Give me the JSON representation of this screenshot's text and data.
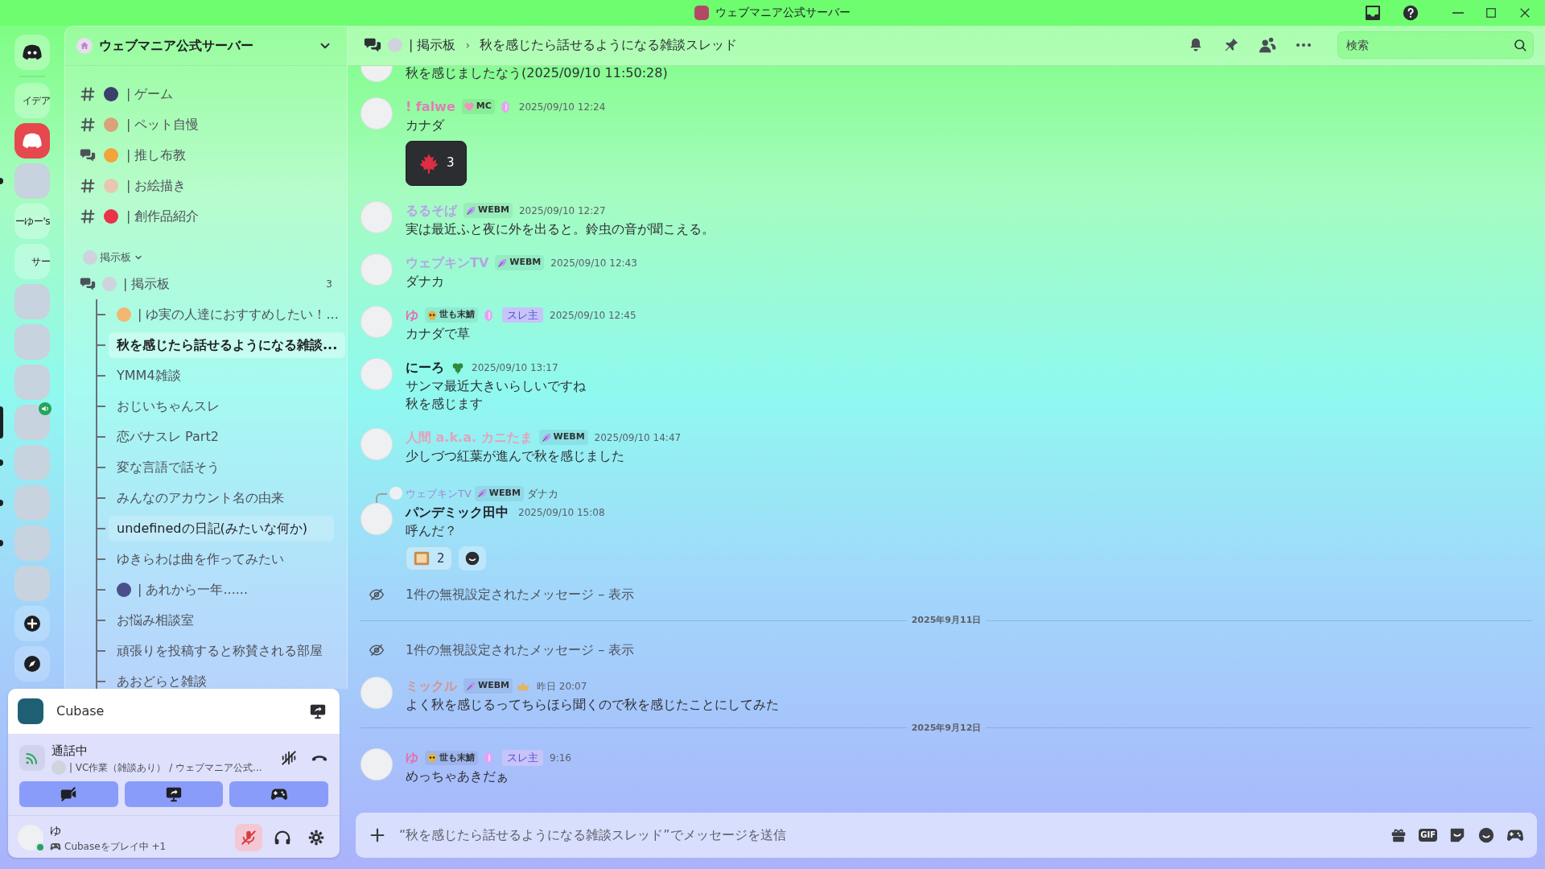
{
  "window": {
    "title": "ウェブマニア公式サーバー"
  },
  "servers": [
    {
      "kind": "home",
      "selected": false,
      "unread": false,
      "in_voice": false
    },
    {
      "kind": "text",
      "label": "イデア",
      "selected": false,
      "unread": false,
      "in_voice": false
    },
    {
      "kind": "logo",
      "selected": false,
      "unread": false,
      "in_voice": false
    },
    {
      "kind": "image",
      "selected": false,
      "unread": true,
      "in_voice": false
    },
    {
      "kind": "text",
      "label": "ーゆー's",
      "selected": false,
      "unread": false,
      "in_voice": false
    },
    {
      "kind": "text",
      "label": "サー",
      "selected": false,
      "unread": false,
      "in_voice": false
    },
    {
      "kind": "image",
      "selected": false,
      "unread": false,
      "in_voice": false
    },
    {
      "kind": "image",
      "selected": false,
      "unread": false,
      "in_voice": false
    },
    {
      "kind": "image",
      "selected": false,
      "unread": false,
      "in_voice": false
    },
    {
      "kind": "image",
      "selected": true,
      "unread": false,
      "in_voice": true
    },
    {
      "kind": "image",
      "selected": false,
      "unread": true,
      "in_voice": false
    },
    {
      "kind": "image",
      "selected": false,
      "unread": true,
      "in_voice": false
    },
    {
      "kind": "image",
      "selected": false,
      "unread": true,
      "in_voice": false
    },
    {
      "kind": "image",
      "selected": false,
      "unread": false,
      "in_voice": false
    },
    {
      "kind": "add",
      "selected": false,
      "unread": false,
      "in_voice": false
    },
    {
      "kind": "explore",
      "selected": false,
      "unread": false,
      "in_voice": false
    }
  ],
  "sidebar": {
    "server_name": "ウェブマニア公式サーバー",
    "channels": [
      {
        "kind": "text",
        "emoji": {
          "kind": "gamepad"
        },
        "name": "| ゲーム"
      },
      {
        "kind": "text",
        "emoji": {
          "kind": "dog"
        },
        "name": "| ペット自慢"
      },
      {
        "kind": "forum",
        "emoji": {
          "kind": "heart-eyes"
        },
        "name": "| 推し布教"
      },
      {
        "kind": "text",
        "emoji": {
          "kind": "palette"
        },
        "name": "| お絵描き"
      },
      {
        "kind": "text",
        "emoji": {
          "kind": "hearts"
        },
        "name": "| 創作品紹介"
      }
    ],
    "category": {
      "label": "掲示板",
      "expanded": true
    },
    "forum": {
      "name": "| 掲示板",
      "count": "3",
      "threads": [
        {
          "emoji": {
            "kind": "wink"
          },
          "name": "| ゆ実の人達におすすめしたい！...",
          "selected": false,
          "hovered": false
        },
        {
          "name": "秋を感じたら話せるようになる雑談...",
          "selected": true,
          "hovered": false
        },
        {
          "name": "YMM4雑談",
          "selected": false,
          "hovered": false
        },
        {
          "name": "おじいちゃんスレ",
          "selected": false,
          "hovered": false
        },
        {
          "name": "恋バナスレ Part2",
          "selected": false,
          "hovered": false
        },
        {
          "name": "変な言語で話そう",
          "selected": false,
          "hovered": false
        },
        {
          "name": "みんなのアカウント名の由来",
          "selected": false,
          "hovered": false
        },
        {
          "name": "undefinedの日記(みたいな何か)",
          "selected": false,
          "hovered": true
        },
        {
          "name": "ゆきらわは曲を作ってみたい",
          "selected": false,
          "hovered": false
        },
        {
          "emoji": {
            "kind": "gate"
          },
          "name": "| あれから一年......",
          "selected": false,
          "hovered": false
        },
        {
          "name": "お悩み相談室",
          "selected": false,
          "hovered": false
        },
        {
          "name": "頑張りを投稿すると称賛される部屋",
          "selected": false,
          "hovered": false
        },
        {
          "name": "あおどらと雑談",
          "selected": false,
          "hovered": false
        }
      ]
    }
  },
  "panel": {
    "activity": "Cubase",
    "voice_status": "通話中",
    "voice_channel": "| VC作業（雑談あり） / ウェブマニア公式...",
    "user": "ゆ",
    "user_status": "Cubaseをプレイ中 +1",
    "mic_muted": true
  },
  "header": {
    "forum": "| 掲示板",
    "separator": "›",
    "thread": "秋を感じたら話せるようになる雑談スレッド",
    "search": {
      "placeholder": "検索"
    }
  },
  "messages": [
    {
      "kind": "continuation",
      "lines": [
        "秋を感じましたなう(2025/09/10 11:50:28)"
      ]
    },
    {
      "kind": "message",
      "author": "! falwe",
      "color": "#e07fb6",
      "tag": {
        "kind": "heart",
        "label": "MC"
      },
      "boost": true,
      "time": "2025/09/10 12:24",
      "lines": [
        "カナダ"
      ],
      "reactions": [
        {
          "kind": "maple",
          "count": "3",
          "selected": true
        }
      ],
      "add_reaction": false
    },
    {
      "kind": "message",
      "author": "るるそば",
      "color": "#b7a2e8",
      "tag": {
        "kind": "leaf",
        "label": "WEBM"
      },
      "boost": false,
      "time": "2025/09/10 12:27",
      "lines": [
        "実は最近ふと夜に外を出ると。鈴虫の音が聞こえる。"
      ]
    },
    {
      "kind": "message",
      "author": "ウェブキンTV",
      "color": "#b3a6e4",
      "tag": {
        "kind": "leaf",
        "label": "WEBM"
      },
      "boost": false,
      "time": "2025/09/10 12:43",
      "lines": [
        "ダナカ"
      ]
    },
    {
      "kind": "message",
      "author": "ゆ",
      "color": "#e46fb0",
      "tag": {
        "kind": "skull",
        "label": "世も末鯖"
      },
      "boost": true,
      "role": "スレ主",
      "time": "2025/09/10 12:45",
      "lines": [
        "カナダで草"
      ]
    },
    {
      "kind": "message",
      "author": "にーろ",
      "color": "#1e1f22",
      "emblem": {
        "kind": "clover"
      },
      "boost": false,
      "time": "2025/09/10 13:17",
      "lines": [
        "サンマ最近大きいらしいですね",
        "秋を感じます"
      ]
    },
    {
      "kind": "message",
      "author": "人間 a.k.a. カニたま",
      "color": "#e3a3bd",
      "tag": {
        "kind": "leaf",
        "label": "WEBM"
      },
      "boost": false,
      "time": "2025/09/10 14:47",
      "lines": [
        "少しづつ紅葉が進んで秋を感じました"
      ]
    },
    {
      "kind": "message",
      "reply": {
        "author": "ウェブキンTV",
        "color": "#9f8ad6",
        "tag": {
          "kind": "leaf",
          "label": "WEBM"
        },
        "text": "ダナカ"
      },
      "author": "パンデミック田中",
      "color": "#1e1f22",
      "boost": false,
      "time": "2025/09/10 15:08",
      "lines": [
        "呼んだ？"
      ],
      "reactions": [
        {
          "kind": "grass",
          "count": "2",
          "selected": false
        }
      ],
      "add_reaction": true
    },
    {
      "kind": "ignored",
      "text": "1件の無視設定されたメッセージ –",
      "link": "表示"
    },
    {
      "kind": "divider",
      "label": "2025年9月11日"
    },
    {
      "kind": "ignored",
      "text": "1件の無視設定されたメッセージ –",
      "link": "表示"
    },
    {
      "kind": "message",
      "author": "ミックル",
      "color": "#d8948a",
      "tag": {
        "kind": "leaf",
        "label": "WEBM"
      },
      "emblem": {
        "kind": "crown"
      },
      "boost": false,
      "time": "昨日 20:07",
      "lines": [
        "よく秋を感じるってちらほら聞くので秋を感じたことにしてみた"
      ]
    },
    {
      "kind": "divider",
      "label": "2025年9月12日"
    },
    {
      "kind": "message",
      "author": "ゆ",
      "color": "#e46fb0",
      "tag": {
        "kind": "skull",
        "label": "世も末鯖"
      },
      "boost": true,
      "role": "スレ主",
      "time": "9:16",
      "lines": [
        "めっちゃあきだぁ"
      ]
    }
  ],
  "composer": {
    "placeholder": "“秋を感じたら話せるようになる雑談スレッド”でメッセージを送信",
    "gif_label": "GIF"
  }
}
